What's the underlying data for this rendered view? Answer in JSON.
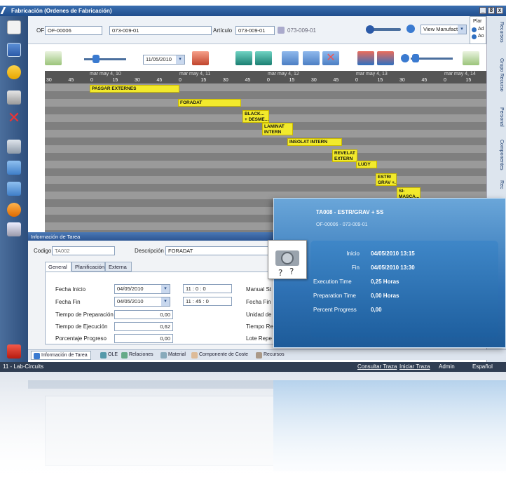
{
  "window": {
    "title": "Fabricación (Ordenes de Fabricación)",
    "controls": [
      "_",
      "8",
      "x"
    ]
  },
  "header": {
    "of_label": "OF",
    "of_value": "OF-00006",
    "of_desc": "073-009-01",
    "article_label": "Artículo",
    "article_value": "073-009-01",
    "article_desc": "073-009-01",
    "view_select": "View Manufactu",
    "plan_label": "Plar",
    "plan_opt1": "Ad",
    "plan_opt2": "Ao"
  },
  "gantt_toolbar": {
    "date": "11/05/2010"
  },
  "timeline": {
    "days": [
      "mar may 4, 10",
      "mar may 4, 11",
      "mar may 4, 12",
      "mar may 4, 13",
      "mar may 4, 14"
    ],
    "ticks": [
      "30",
      "45",
      "0",
      "15",
      "30",
      "45",
      "0",
      "15",
      "30",
      "45",
      "0",
      "15",
      "30",
      "45",
      "0",
      "15",
      "30",
      "45",
      "0",
      "15"
    ]
  },
  "tasks": [
    {
      "name": "PASSAR EXTERNES",
      "sub": ""
    },
    {
      "name": "FORADAT",
      "sub": ""
    },
    {
      "name": "BLACK...",
      "sub": "+ DESME..."
    },
    {
      "name": "LAMINAT",
      "sub": "INTERN"
    },
    {
      "name": "INSOLAT INTERN",
      "sub": ""
    },
    {
      "name": "REVELAT",
      "sub": "EXTERN"
    },
    {
      "name": "LUDY",
      "sub": ""
    },
    {
      "name": "ESTR/",
      "sub": "GRAV +..."
    },
    {
      "name": "SI-",
      "sub": "MASCA..."
    }
  ],
  "right_tabs": [
    "Recursos",
    "Grupo Recurso",
    "Personal",
    "Componentes",
    "Rec"
  ],
  "info_panel": {
    "header": "Información de Tarea",
    "codigo_label": "Codigo",
    "codigo_value": "TA002",
    "descripcion_label": "Descripción",
    "descripcion_value": "FORADAT",
    "tabs": [
      "General",
      "Planificación",
      "Externa"
    ],
    "fields": {
      "fecha_inicio_label": "Fecha Inicio",
      "fecha_inicio": "04/05/2010",
      "hora_inicio": "11 : 0 : 0",
      "fecha_fin_label": "Fecha Fin",
      "fecha_fin": "04/05/2010",
      "hora_fin": "11 : 45 : 0",
      "prep_label": "Tiempo de Preparación",
      "prep_value": "0,00",
      "exec_label": "Tiempo de Ejecución",
      "exec_value": "0,62",
      "pct_label": "Porcentaje Progreso",
      "pct_value": "0,00",
      "manual_label": "Manual St",
      "fecha_fin2_label": "Fecha Fin",
      "unidad_label": "Unidad de",
      "tiempo_re_label": "Tiempo Re",
      "lote_label": "Lote Repe"
    }
  },
  "bottom_tabs": [
    "Información de Tarea",
    "OLE",
    "Relaciones",
    "Material",
    "Componente de Coste",
    "Recursos"
  ],
  "status": {
    "left": "11 - Lab-Circuits",
    "consultar": "Consultar Traza",
    "iniciar": "Iniciar Traza",
    "admin": "Admin",
    "lang": "Español"
  },
  "popup": {
    "title": "TA008 - ESTR/GRAV + SS",
    "subtitle": "OF-00006 - 073-009-01",
    "inicio_label": "Inicio",
    "inicio_value": "04/05/2010 13:15",
    "fin_label": "Fin",
    "fin_value": "04/05/2010 13:30",
    "exec_label": "Execution Time",
    "exec_value": "0,25 Horas",
    "prep_label": "Preparation Time",
    "prep_value": "0,00 Horas",
    "pct_label": "Percent Progress",
    "pct_value": "0,00"
  }
}
